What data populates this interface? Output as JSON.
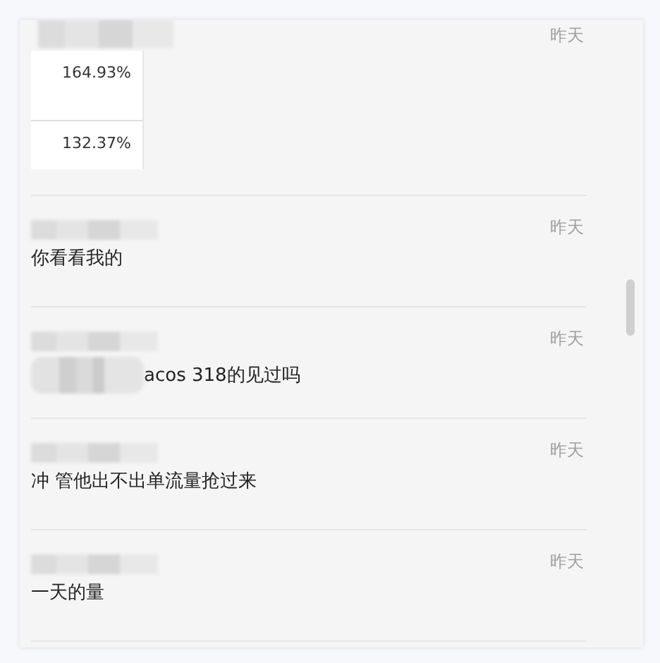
{
  "messages": [
    {
      "kind": "table",
      "time": "昨天",
      "cells": [
        "164.93%",
        "132.37%"
      ],
      "redacted_prefix": false
    },
    {
      "kind": "text",
      "time": "昨天",
      "text": "你看看我的",
      "redacted_prefix": false
    },
    {
      "kind": "text",
      "time": "昨天",
      "text": "acos 318的见过吗",
      "redacted_prefix": true
    },
    {
      "kind": "text",
      "time": "昨天",
      "text": "冲 管他出不出单流量抢过来",
      "redacted_prefix": false
    },
    {
      "kind": "text",
      "time": "昨天",
      "text": "一天的量",
      "redacted_prefix": false
    }
  ]
}
